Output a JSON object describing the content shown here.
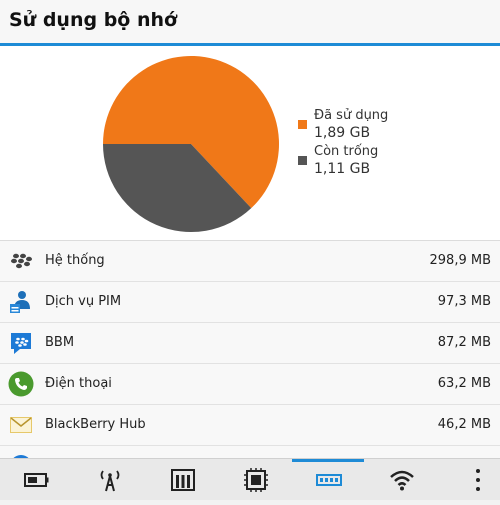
{
  "header": {
    "title": "Sử dụng bộ nhớ"
  },
  "chart_data": {
    "type": "pie",
    "slices": [
      {
        "label": "Đã sử dụng",
        "value": 1.89,
        "display": "1,89 GB",
        "color": "#f07818"
      },
      {
        "label": "Còn trống",
        "value": 1.11,
        "display": "1,11 GB",
        "color": "#555555"
      }
    ],
    "unit": "GB",
    "legend_position": "right"
  },
  "list": {
    "items": [
      {
        "name": "Hệ thống",
        "size": "298,9 MB",
        "icon": "blackberry-logo-icon"
      },
      {
        "name": "Dịch vụ PIM",
        "size": "97,3 MB",
        "icon": "pim-icon"
      },
      {
        "name": "BBM",
        "size": "87,2 MB",
        "icon": "bbm-icon"
      },
      {
        "name": "Điện thoại",
        "size": "63,2 MB",
        "icon": "phone-icon"
      },
      {
        "name": "BlackBerry Hub",
        "size": "46,2 MB",
        "icon": "hub-envelope-icon"
      }
    ]
  },
  "toolbar": {
    "tabs": [
      {
        "name": "battery-icon",
        "active": false
      },
      {
        "name": "antenna-icon",
        "active": false
      },
      {
        "name": "storage-icon",
        "active": false
      },
      {
        "name": "cpu-icon",
        "active": false
      },
      {
        "name": "memory-icon",
        "active": true
      },
      {
        "name": "wifi-icon",
        "active": false
      }
    ]
  },
  "colors": {
    "accent": "#1e8bd6",
    "used": "#f07818",
    "free": "#555555"
  }
}
